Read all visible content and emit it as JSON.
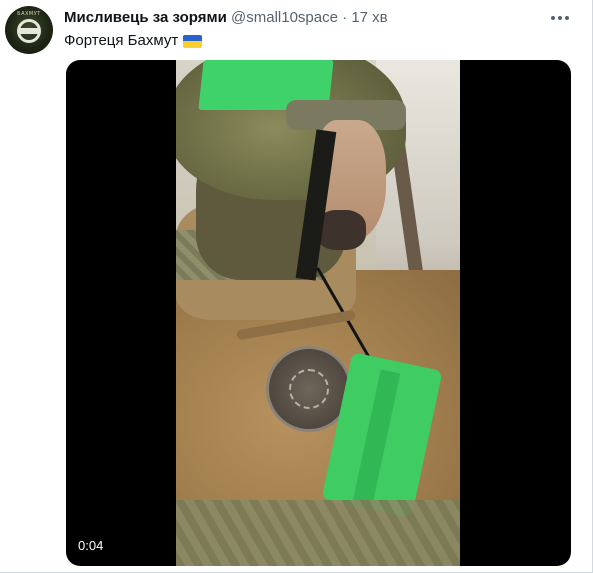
{
  "tweet": {
    "display_name": "Мисливець за зорями",
    "handle": "@small10space",
    "separator": "·",
    "time": "17 хв",
    "text": "Фортеця Бахмут",
    "flag_icon": "ukraine-flag-icon"
  },
  "media": {
    "timestamp": "0:04"
  },
  "colors": {
    "name": "#0f1419",
    "secondary": "#536471",
    "media_bg": "#000000"
  }
}
